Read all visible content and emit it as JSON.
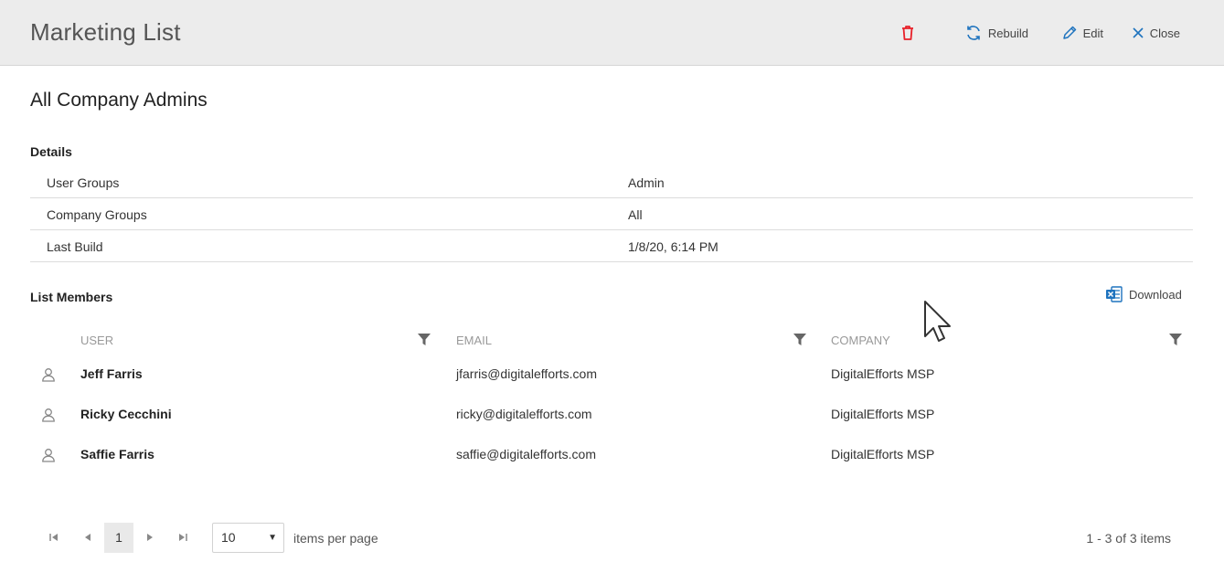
{
  "app": {
    "title": "Marketing List"
  },
  "toolbar": {
    "delete_icon": "trash-icon",
    "rebuild_label": "Rebuild",
    "edit_label": "Edit",
    "close_label": "Close",
    "delete_color": "#e8212a",
    "accent_color": "#1e73be"
  },
  "record": {
    "title": "All Company Admins"
  },
  "details": {
    "section_label": "Details",
    "rows": [
      {
        "key": "User Groups",
        "value": "Admin"
      },
      {
        "key": "Company Groups",
        "value": "All"
      },
      {
        "key": "Last Build",
        "value": "1/8/20, 6:14 PM"
      }
    ]
  },
  "members": {
    "section_label": "List Members",
    "download_label": "Download",
    "columns": [
      "USER",
      "EMAIL",
      "COMPANY"
    ],
    "rows": [
      {
        "user": "Jeff Farris",
        "email": "jfarris@digitalefforts.com",
        "company": "DigitalEfforts MSP"
      },
      {
        "user": "Ricky Cecchini",
        "email": "ricky@digitalefforts.com",
        "company": "DigitalEfforts MSP"
      },
      {
        "user": "Saffie Farris",
        "email": "saffie@digitalefforts.com",
        "company": "DigitalEfforts MSP"
      }
    ]
  },
  "pager": {
    "current_page": "1",
    "page_size": "10",
    "items_per_page_label": "items per page",
    "info": "1 - 3 of 3 items"
  }
}
